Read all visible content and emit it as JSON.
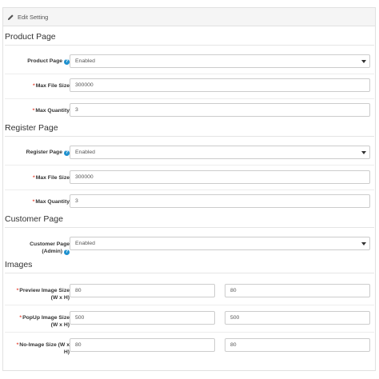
{
  "panel": {
    "heading": "Edit Setting"
  },
  "sections": {
    "product": {
      "title": "Product Page",
      "page_label": "Product Page",
      "page_value": "Enabled",
      "max_file_label": "Max File Size",
      "max_file_value": "300000",
      "max_qty_label": "Max Quantity",
      "max_qty_value": "3"
    },
    "register": {
      "title": "Register Page",
      "page_label": "Register Page",
      "page_value": "Enabled",
      "max_file_label": "Max File Size",
      "max_file_value": "300000",
      "max_qty_label": "Max Quantity",
      "max_qty_value": "3"
    },
    "customer": {
      "title": "Customer Page",
      "page_label_line1": "Customer Page",
      "page_label_line2": "(Admin)",
      "page_value": "Enabled"
    },
    "images": {
      "title": "Images",
      "preview_label_line1": "Preview Image Size",
      "preview_label_line2": "(W x H)",
      "preview_w": "80",
      "preview_h": "80",
      "popup_label_line1": "PopUp Image Size",
      "popup_label_line2": "(W x H)",
      "popup_w": "500",
      "popup_h": "500",
      "noimage_label_line1": "No-Image Size (W x",
      "noimage_label_line2": "H)",
      "noimage_w": "80",
      "noimage_h": "80"
    }
  },
  "glyphs": {
    "required": "*",
    "help": "?"
  },
  "colors": {
    "required": "#e74c3c",
    "help_icon": "#1e91cf"
  }
}
